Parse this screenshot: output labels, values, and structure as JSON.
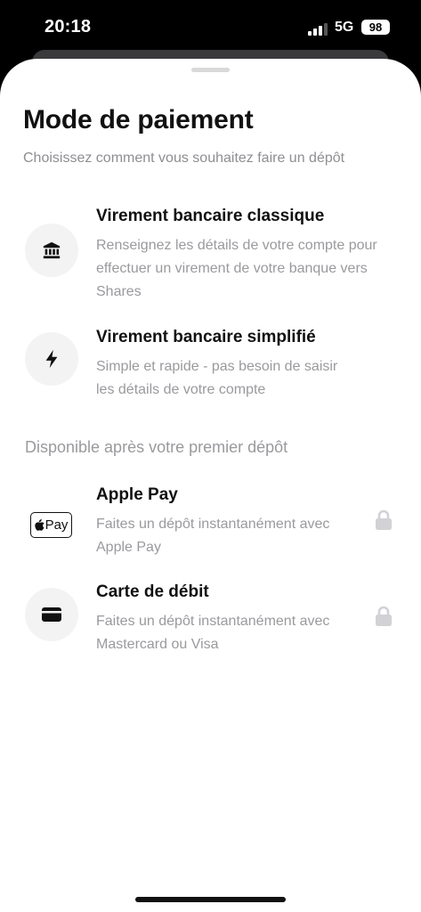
{
  "status_bar": {
    "time": "20:18",
    "network": "5G",
    "battery": "98"
  },
  "sheet": {
    "title": "Mode de paiement",
    "subtitle": "Choisissez comment vous souhaitez faire un dépôt",
    "options": [
      {
        "title": "Virement bancaire classique",
        "description": "Renseignez les détails de votre compte pour effectuer un virement de votre banque vers Shares",
        "icon": "bank-icon"
      },
      {
        "title": "Virement bancaire simplifié",
        "description": "Simple et rapide - pas besoin de saisir les détails de votre compte",
        "icon": "lightning-icon"
      }
    ],
    "locked_section_label": "Disponible après votre premier dépôt",
    "locked_options": [
      {
        "title": "Apple Pay",
        "description": "Faites un dépôt instantanément avec Apple Pay",
        "badge_text": "Pay",
        "icon": "apple-pay-icon",
        "locked": true
      },
      {
        "title": "Carte de débit",
        "description": "Faites un dépôt instantanément avec Mastercard ou Visa",
        "icon": "credit-card-icon",
        "locked": true
      }
    ]
  },
  "colors": {
    "background": "#000000",
    "sheet": "#ffffff",
    "icon_circle": "#f3f3f4",
    "muted_text": "#9a9a9e",
    "lock": "#d1d1d6"
  }
}
